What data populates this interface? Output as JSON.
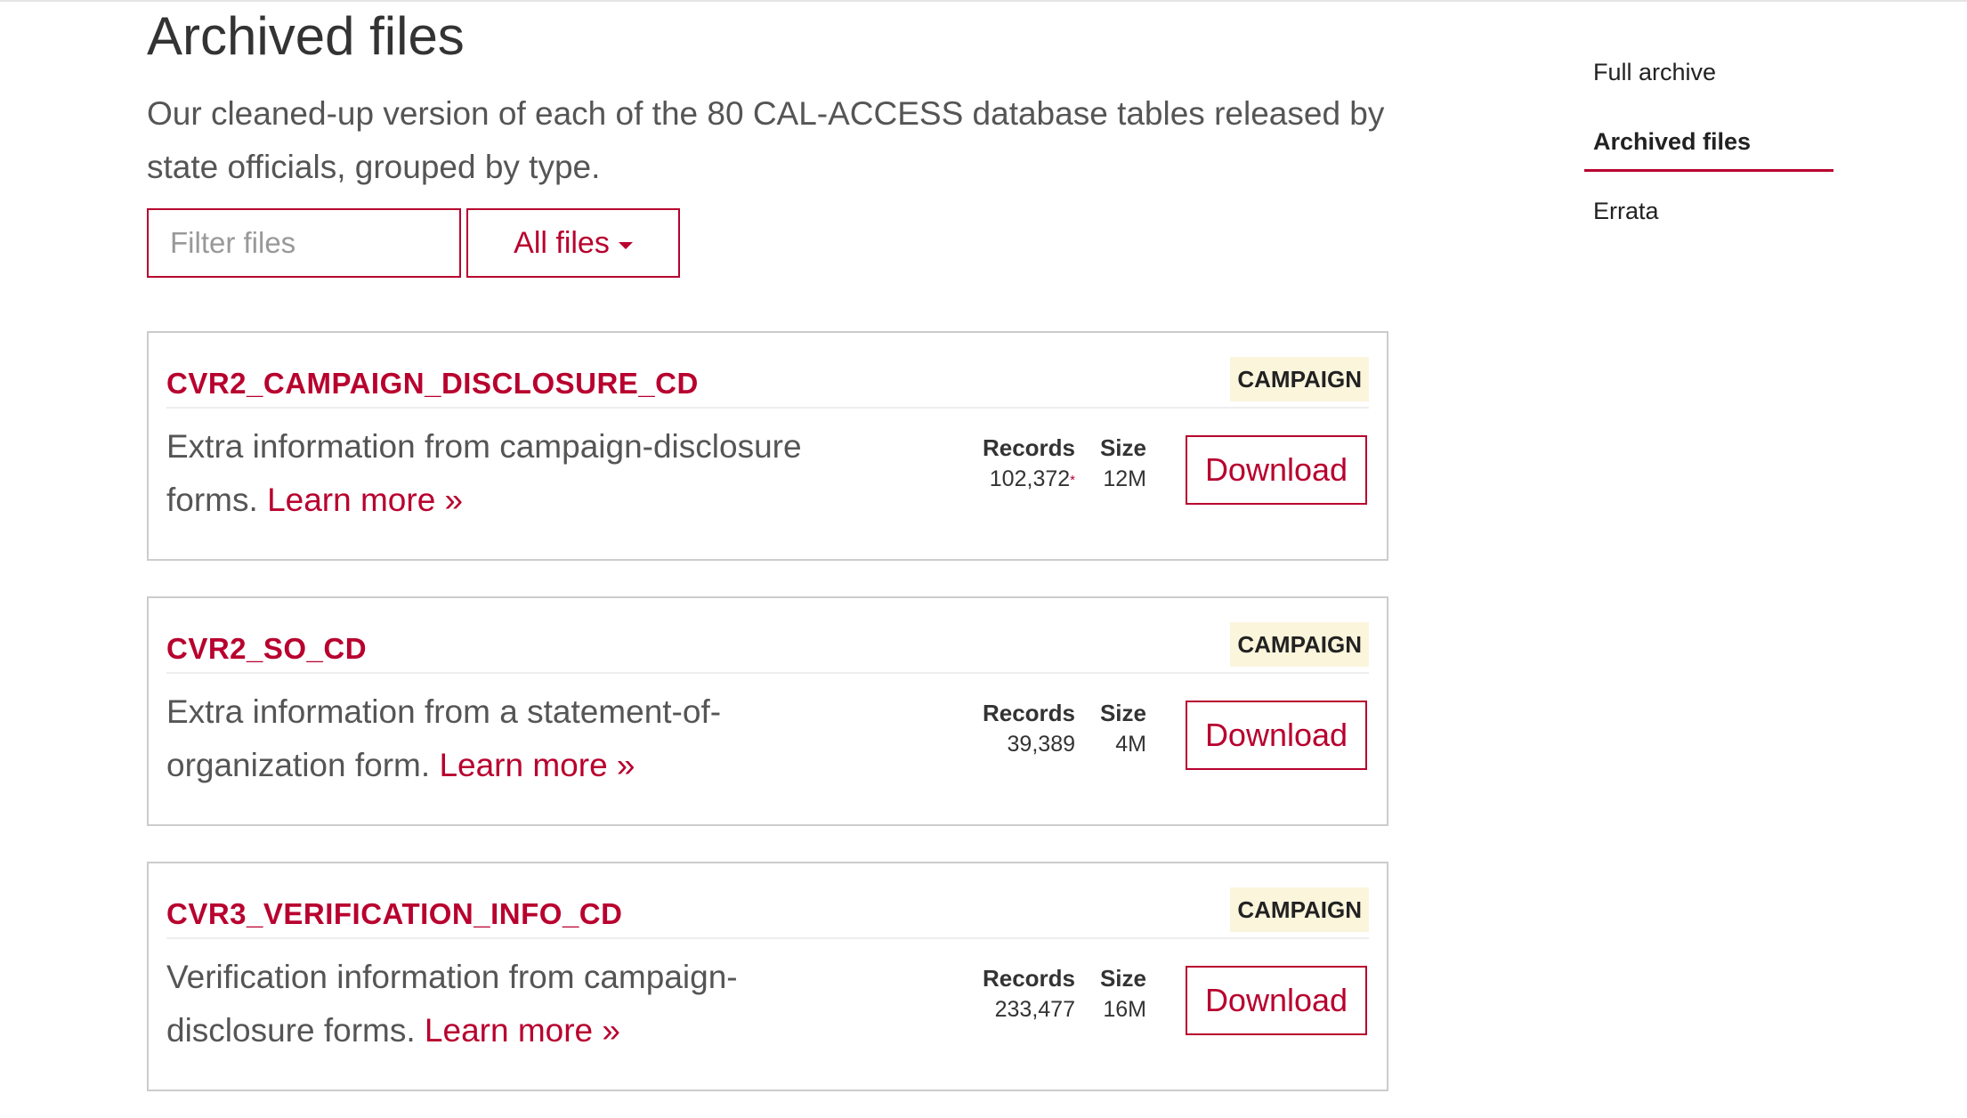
{
  "page": {
    "title": "Archived files",
    "subtitle": "Our cleaned-up version of each of the 80 CAL-ACCESS database tables released by state officials, grouped by type."
  },
  "filter": {
    "placeholder": "Filter files",
    "dropdown_label": "All files"
  },
  "cards": [
    {
      "name": "CVR2_CAMPAIGN_DISCLOSURE_CD",
      "badge": "CAMPAIGN",
      "description": "Extra information from campaign-disclosure forms.",
      "learn_more": "Learn more »",
      "records_label": "Records",
      "records": "102,372",
      "records_note": "*",
      "size_label": "Size",
      "size": "12M",
      "download_label": "Download"
    },
    {
      "name": "CVR2_SO_CD",
      "badge": "CAMPAIGN",
      "description": "Extra information from a statement-of-organization form.",
      "learn_more": "Learn more »",
      "records_label": "Records",
      "records": "39,389",
      "records_note": "",
      "size_label": "Size",
      "size": "4M",
      "download_label": "Download"
    },
    {
      "name": "CVR3_VERIFICATION_INFO_CD",
      "badge": "CAMPAIGN",
      "description": "Verification information from campaign-disclosure forms.",
      "learn_more": "Learn more »",
      "records_label": "Records",
      "records": "233,477",
      "records_note": "",
      "size_label": "Size",
      "size": "16M",
      "download_label": "Download"
    }
  ],
  "sidebar": {
    "items": [
      {
        "label": "Full archive",
        "active": false
      },
      {
        "label": "Archived files",
        "active": true
      },
      {
        "label": "Errata",
        "active": false
      }
    ]
  },
  "colors": {
    "accent": "#b8002e",
    "badge_bg": "#fbf5dc",
    "card_border": "#cccccc"
  }
}
